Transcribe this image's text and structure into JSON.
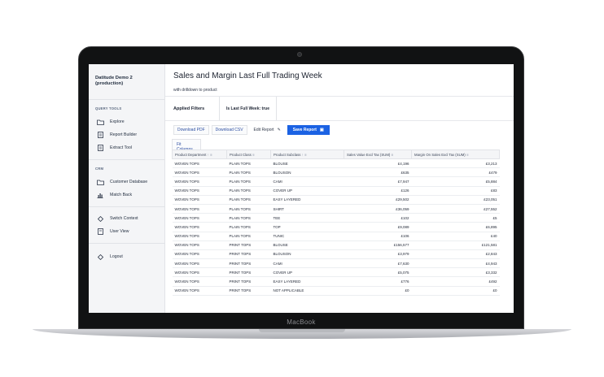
{
  "device": {
    "brand_label": "MacBook"
  },
  "sidebar": {
    "workspace": "Datitude Demo 2 (production)",
    "sections": [
      {
        "title": "QUERY TOOLS",
        "items": [
          {
            "label": "Explore",
            "icon": "folder-icon"
          },
          {
            "label": "Report Builder",
            "icon": "document-icon"
          },
          {
            "label": "Extract Tool",
            "icon": "document-icon"
          }
        ]
      },
      {
        "title": "CRM",
        "items": [
          {
            "label": "Customer Database",
            "icon": "folder-icon"
          },
          {
            "label": "Match Back",
            "icon": "chart-icon"
          }
        ]
      },
      {
        "title": "",
        "items": [
          {
            "label": "Switch Context",
            "icon": "swap-icon"
          },
          {
            "label": "User View",
            "icon": "document-icon"
          }
        ]
      },
      {
        "title": "",
        "items": [
          {
            "label": "Logout",
            "icon": "logout-icon"
          }
        ]
      }
    ]
  },
  "report": {
    "title": "Sales and Margin Last Full Trading Week",
    "subtitle": "with drilldown to product",
    "filters_label": "Applied Filters",
    "filter_chip": "Is Last Full Week: true",
    "actions": {
      "download_pdf": "Download PDF",
      "download_csv": "Download CSV",
      "edit_report": "Edit Report",
      "save_report": "Save Report"
    },
    "fit_columns": "Fit Columns",
    "columns": [
      "Product Department",
      "Product Class",
      "Product Subclass",
      "Sales Value Excl Tax (SUM)",
      "Margin On Sales Excl Tax (SUM)"
    ],
    "rows": [
      [
        "WOVEN TOPS",
        "PLAIN TOPS",
        "BLOUSE",
        "£4,196",
        "£3,213"
      ],
      [
        "WOVEN TOPS",
        "PLAIN TOPS",
        "BLOUSON",
        "£635",
        "£479"
      ],
      [
        "WOVEN TOPS",
        "PLAIN TOPS",
        "CAMI",
        "£7,947",
        "£5,884"
      ],
      [
        "WOVEN TOPS",
        "PLAIN TOPS",
        "COVER UP",
        "£126",
        "£83"
      ],
      [
        "WOVEN TOPS",
        "PLAIN TOPS",
        "EASY LAYERED",
        "£29,502",
        "£23,051"
      ],
      [
        "WOVEN TOPS",
        "PLAIN TOPS",
        "SHIRT",
        "£36,059",
        "£27,552"
      ],
      [
        "WOVEN TOPS",
        "PLAIN TOPS",
        "TEE",
        "£102",
        "£5"
      ],
      [
        "WOVEN TOPS",
        "PLAIN TOPS",
        "TOP",
        "£9,089",
        "£6,895"
      ],
      [
        "WOVEN TOPS",
        "PLAIN TOPS",
        "TUNIC",
        "£106",
        "£40"
      ],
      [
        "WOVEN TOPS",
        "PRINT TOPS",
        "BLOUSE",
        "£156,577",
        "£121,581"
      ],
      [
        "WOVEN TOPS",
        "PRINT TOPS",
        "BLOUSON",
        "£3,979",
        "£2,843"
      ],
      [
        "WOVEN TOPS",
        "PRINT TOPS",
        "CAMI",
        "£7,630",
        "£4,943"
      ],
      [
        "WOVEN TOPS",
        "PRINT TOPS",
        "COVER UP",
        "£5,075",
        "£3,332"
      ],
      [
        "WOVEN TOPS",
        "PRINT TOPS",
        "EASY LAYERED",
        "£776",
        "£492"
      ],
      [
        "WOVEN TOPS",
        "PRINT TOPS",
        "NOT APPLICABLE",
        "£0",
        "£0"
      ]
    ]
  }
}
